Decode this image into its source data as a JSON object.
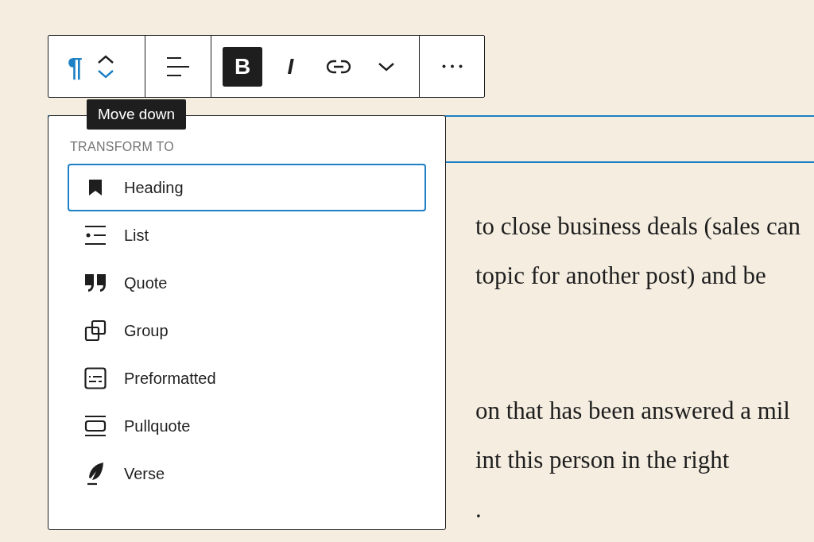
{
  "toolbar": {
    "block_type": {
      "label": "¶"
    },
    "movers": [
      {
        "kind": "up",
        "highlighted": false
      },
      {
        "kind": "down",
        "highlighted": true
      }
    ],
    "buttons": [
      {
        "kind": "bold",
        "label": "B",
        "on": true
      },
      {
        "kind": "italic",
        "label": "I",
        "on": false
      },
      {
        "kind": "link",
        "on": false
      },
      {
        "kind": "more-format",
        "on": false
      }
    ]
  },
  "tooltip": "Move down",
  "transform_menu": {
    "title": "TRANSFORM TO",
    "items": [
      {
        "kind": "heading",
        "label": "Heading",
        "selected": true
      },
      {
        "kind": "list",
        "label": "List",
        "selected": false
      },
      {
        "kind": "quote",
        "label": "Quote",
        "selected": false
      },
      {
        "kind": "group",
        "label": "Group",
        "selected": false
      },
      {
        "kind": "preformatted",
        "label": "Preformatted",
        "selected": false
      },
      {
        "kind": "pullquote",
        "label": "Pullquote",
        "selected": false
      },
      {
        "kind": "verse",
        "label": "Verse",
        "selected": false
      }
    ]
  },
  "paragraphs": [
    [
      "to close business deals (sales can",
      "topic for another post) and be"
    ],
    [
      "on that has been answered a mil",
      "int this person in the right",
      "."
    ]
  ]
}
